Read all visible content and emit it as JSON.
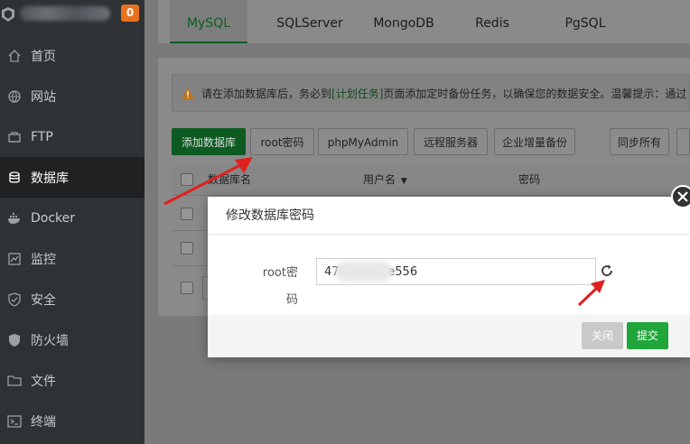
{
  "sidebar": {
    "badge": "0",
    "items": [
      {
        "label": "首页",
        "icon": "home-icon"
      },
      {
        "label": "网站",
        "icon": "globe-icon"
      },
      {
        "label": "FTP",
        "icon": "ftp-icon"
      },
      {
        "label": "数据库",
        "icon": "database-icon",
        "active": true
      },
      {
        "label": "Docker",
        "icon": "docker-icon"
      },
      {
        "label": "监控",
        "icon": "monitor-icon"
      },
      {
        "label": "安全",
        "icon": "shield-icon"
      },
      {
        "label": "防火墙",
        "icon": "firewall-icon"
      },
      {
        "label": "文件",
        "icon": "folder-icon"
      },
      {
        "label": "终端",
        "icon": "terminal-icon"
      }
    ]
  },
  "tabs": [
    "MySQL",
    "SQLServer",
    "MongoDB",
    "Redis",
    "PgSQL"
  ],
  "active_tab": "MySQL",
  "notice": {
    "prefix": "请在添加数据库后，务必到",
    "link": "[计划任务]",
    "suffix": "页面添加定时备份任务，以确保您的数据安全。温馨提示：通过"
  },
  "toolbar": {
    "add_db": "添加数据库",
    "root_pwd": "root密码",
    "phpmyadmin": "phpMyAdmin",
    "remote_server": "远程服务器",
    "incremental_backup": "企业增量备份",
    "sync_all": "同步所有"
  },
  "table": {
    "columns": [
      "数据库名",
      "用户名",
      "密码"
    ]
  },
  "dialog": {
    "title": "修改数据库密码",
    "field_label": "root密码",
    "field_value": "470         1e556",
    "close_label": "关闭",
    "submit_label": "提交"
  },
  "colors": {
    "accent": "#20a53a",
    "sidebar_bg": "#2f3235",
    "arrow": "#e02020",
    "badge": "#e8711f"
  }
}
